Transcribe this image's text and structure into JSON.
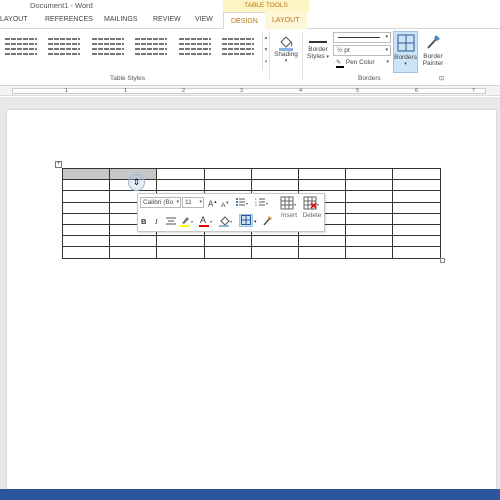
{
  "title_bar": {
    "document_title": "Document1 - Word",
    "context_label": "TABLE TOOLS"
  },
  "tabs": [
    "LAYOUT",
    "REFERENCES",
    "MAILINGS",
    "REVIEW",
    "VIEW",
    "DESIGN",
    "LAYOUT"
  ],
  "active_tab": "DESIGN",
  "ribbon": {
    "table_styles_label": "Table Styles",
    "shading": {
      "label": "Shading",
      "dropdown": "▾"
    },
    "border_styles": {
      "label1": "Border",
      "label2": "Styles",
      "dropdown": "▾"
    },
    "pen_weight": "½ pt",
    "pen_color": "Pen Color",
    "borders_btn": {
      "label": "Borders",
      "dropdown": "▾"
    },
    "border_painter": {
      "label1": "Border",
      "label2": "Painter"
    },
    "borders_group_label": "Borders",
    "dialog_launcher": "⊡"
  },
  "ruler": {
    "marks": [
      "1",
      "1",
      "2",
      "3",
      "4",
      "5",
      "6",
      "7"
    ]
  },
  "table": {
    "rows": 8,
    "cols": 8,
    "selected_cells": [
      [
        0,
        0
      ],
      [
        0,
        1
      ]
    ]
  },
  "mini_toolbar": {
    "font_name": "Calibri (Bo",
    "font_size": "11",
    "bold": "B",
    "italic": "I",
    "grow_font": "A",
    "shrink_font": "A",
    "insert_label": "Insert",
    "delete_label": "Delete"
  },
  "accent_color": "#2b579a",
  "context_tab_color": "#b7770f",
  "highlight_color": "#ffff00",
  "font_color": "#e00000",
  "cursor_glyph": "⇕"
}
